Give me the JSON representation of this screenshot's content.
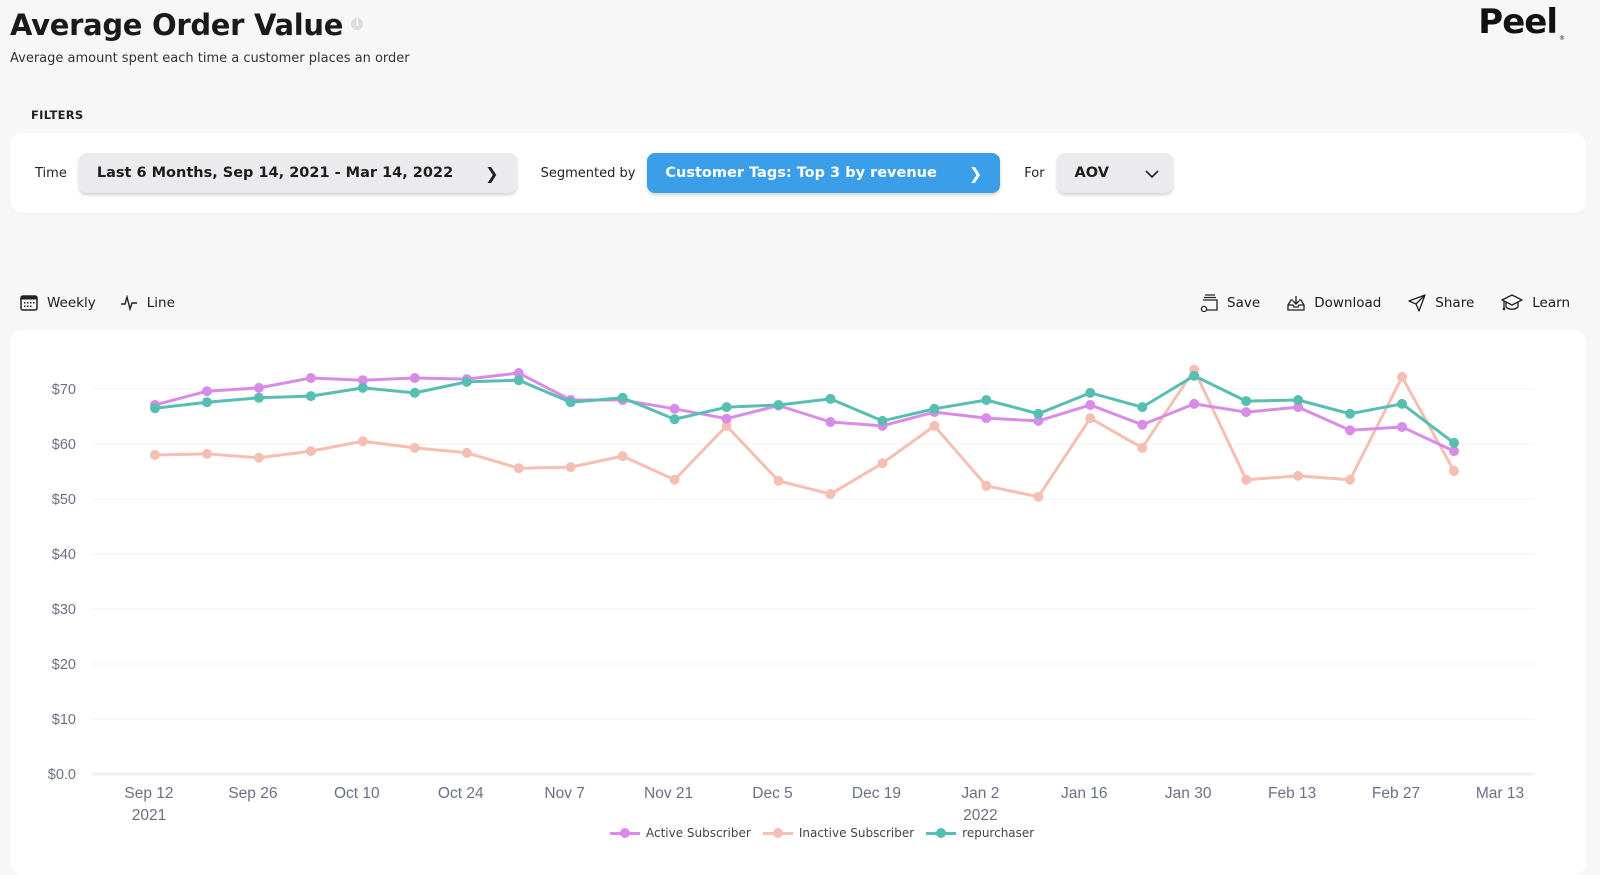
{
  "header": {
    "title": "Average Order Value",
    "subtitle": "Average amount spent each time a customer places an order",
    "logo": "Peel",
    "info_icon": "info-icon"
  },
  "filters": {
    "section_label": "FILTERS",
    "time_label": "Time",
    "time_value": "Last 6 Months, Sep 14, 2021 - Mar 14, 2022",
    "segment_label": "Segmented by",
    "segment_value": "Customer Tags: Top 3 by revenue",
    "for_label": "For",
    "for_value": "AOV",
    "accent_color": "#3a9ee8"
  },
  "toolbar": {
    "granularity": "Weekly",
    "chart_type": "Line",
    "save": "Save",
    "download": "Download",
    "share": "Share",
    "learn": "Learn"
  },
  "chart_data": {
    "type": "line",
    "title": "Average Order Value",
    "xlabel": "",
    "ylabel": "",
    "ylim": [
      0,
      75
    ],
    "yticks": [
      "$0.0",
      "$10",
      "$20",
      "$30",
      "$40",
      "$50",
      "$60",
      "$70"
    ],
    "ytick_values": [
      0,
      10,
      20,
      30,
      40,
      50,
      60,
      70
    ],
    "xticks": [
      {
        "label": "Sep 12",
        "sub": "2021",
        "index": 0
      },
      {
        "label": "Sep 26",
        "sub": "",
        "index": 2
      },
      {
        "label": "Oct 10",
        "sub": "",
        "index": 4
      },
      {
        "label": "Oct 24",
        "sub": "",
        "index": 6
      },
      {
        "label": "Nov 7",
        "sub": "",
        "index": 8
      },
      {
        "label": "Nov 21",
        "sub": "",
        "index": 10
      },
      {
        "label": "Dec 5",
        "sub": "",
        "index": 12
      },
      {
        "label": "Dec 19",
        "sub": "",
        "index": 14
      },
      {
        "label": "Jan 2",
        "sub": "2022",
        "index": 16
      },
      {
        "label": "Jan 16",
        "sub": "",
        "index": 18
      },
      {
        "label": "Jan 30",
        "sub": "",
        "index": 20
      },
      {
        "label": "Feb 13",
        "sub": "",
        "index": 22
      },
      {
        "label": "Feb 27",
        "sub": "",
        "index": 24
      },
      {
        "label": "Mar 13",
        "sub": "",
        "index": 26
      }
    ],
    "grid": true,
    "legend_position": "bottom-center",
    "series": [
      {
        "name": "Active Subscriber",
        "color": "#d98be8",
        "values": [
          67.1,
          69.6,
          70.2,
          72.0,
          71.6,
          72.0,
          71.8,
          72.9,
          68.0,
          68.0,
          66.4,
          64.6,
          67.0,
          64.0,
          63.3,
          65.8,
          64.7,
          64.2,
          67.1,
          63.5,
          67.3,
          65.8,
          66.7,
          62.5,
          63.1,
          58.7
        ]
      },
      {
        "name": "Inactive Subscriber",
        "color": "#f5bfb3",
        "values": [
          58.0,
          58.2,
          57.5,
          58.7,
          60.5,
          59.3,
          58.4,
          55.6,
          55.8,
          57.8,
          53.5,
          63.3,
          53.3,
          50.9,
          56.5,
          63.3,
          52.4,
          50.4,
          64.7,
          59.3,
          73.5,
          53.5,
          54.2,
          53.5,
          72.2,
          55.1
        ]
      },
      {
        "name": "repurchaser",
        "color": "#57bfb2",
        "values": [
          66.5,
          67.6,
          68.4,
          68.7,
          70.2,
          69.3,
          71.3,
          71.6,
          67.6,
          68.4,
          64.5,
          66.7,
          67.1,
          68.2,
          64.2,
          66.4,
          68.0,
          65.5,
          69.3,
          66.7,
          72.4,
          67.8,
          68.0,
          65.5,
          67.3,
          60.2
        ]
      }
    ]
  }
}
